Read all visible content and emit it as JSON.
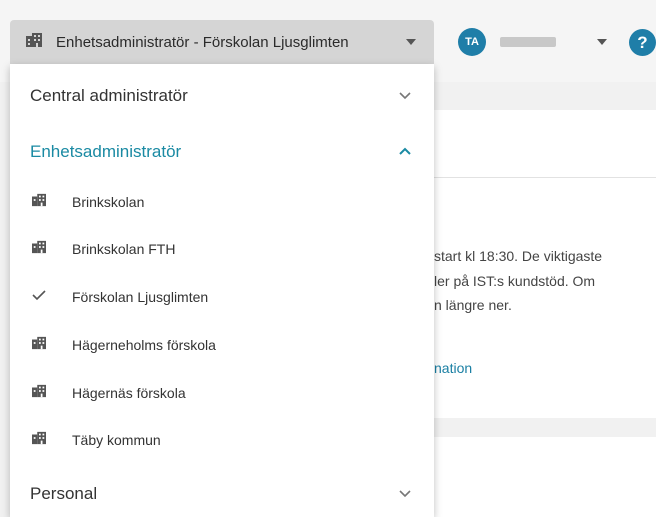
{
  "topbar": {
    "role_select_label": "Enhetsadministratör - Förskolan Ljusglimten",
    "avatar_initials": "TA",
    "help_label": "?"
  },
  "background": {
    "line1": "start kl 18:30. De viktigaste",
    "line2": "ler på IST:s kundstöd. Om",
    "line3": "n längre ner.",
    "link": "nation"
  },
  "menu": {
    "groups": [
      {
        "label": "Central administratör",
        "expanded": false
      },
      {
        "label": "Enhetsadministratör",
        "expanded": true
      },
      {
        "label": "Personal",
        "expanded": false
      }
    ],
    "items": [
      {
        "label": "Brinkskolan",
        "icon": "building-icon",
        "selected": false
      },
      {
        "label": "Brinkskolan FTH",
        "icon": "building-icon",
        "selected": false
      },
      {
        "label": "Förskolan Ljusglimten",
        "icon": "check-icon",
        "selected": true
      },
      {
        "label": "Hägerneholms förskola",
        "icon": "building-icon",
        "selected": false
      },
      {
        "label": "Hägernäs förskola",
        "icon": "building-icon",
        "selected": false
      },
      {
        "label": "Täby kommun",
        "icon": "building-icon",
        "selected": false
      }
    ]
  },
  "colors": {
    "accent": "#1a8aa3",
    "avatar": "#1f7ea8",
    "select_bg": "#d5d5d5"
  }
}
